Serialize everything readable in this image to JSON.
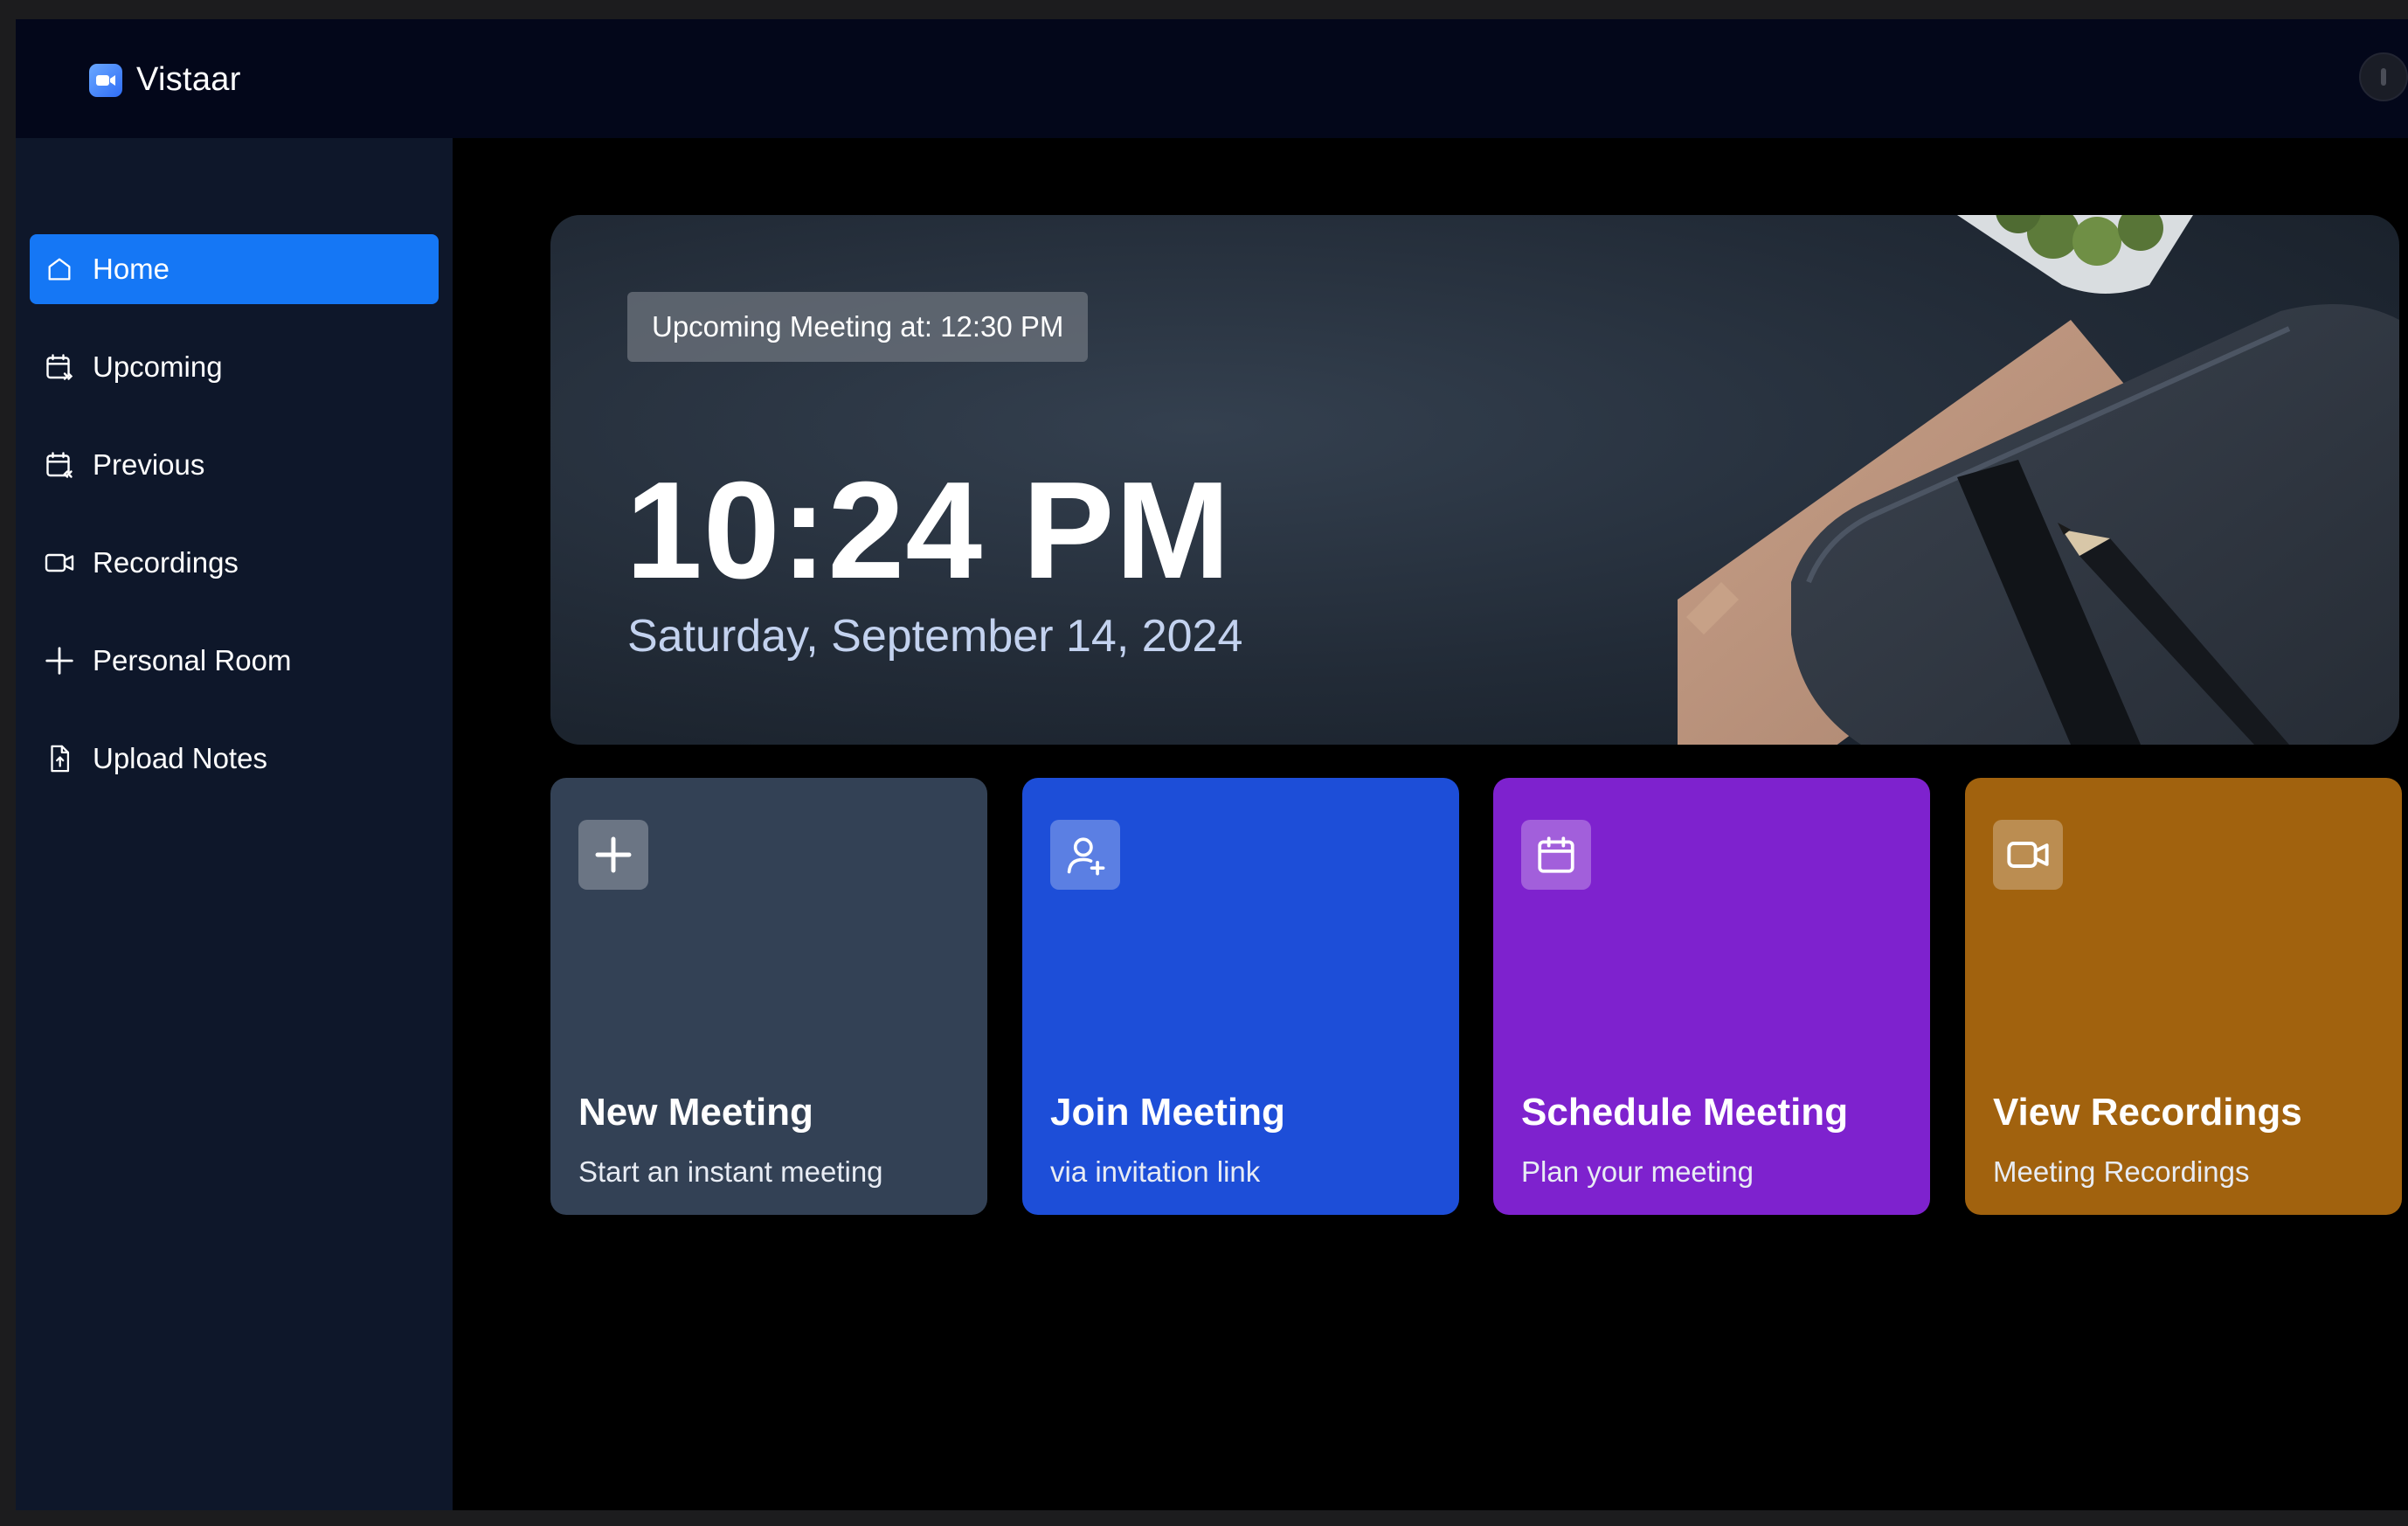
{
  "app": {
    "name": "Vistaar"
  },
  "sidebar": {
    "items": [
      {
        "label": "Home",
        "icon": "home-icon",
        "active": true
      },
      {
        "label": "Upcoming",
        "icon": "calendar-forward-icon",
        "active": false
      },
      {
        "label": "Previous",
        "icon": "calendar-back-icon",
        "active": false
      },
      {
        "label": "Recordings",
        "icon": "video-icon",
        "active": false
      },
      {
        "label": "Personal Room",
        "icon": "plus-icon",
        "active": false
      },
      {
        "label": "Upload Notes",
        "icon": "file-upload-icon",
        "active": false
      }
    ]
  },
  "hero": {
    "badge": "Upcoming Meeting at: 12:30 PM",
    "time": "10:24 PM",
    "date": "Saturday, September 14, 2024"
  },
  "cards": [
    {
      "title": "New Meeting",
      "subtitle": "Start an instant meeting",
      "icon": "plus-icon",
      "color": "#334155"
    },
    {
      "title": "Join Meeting",
      "subtitle": "via invitation link",
      "icon": "user-plus-icon",
      "color": "#1d4ed8"
    },
    {
      "title": "Schedule Meeting",
      "subtitle": "Plan your meeting",
      "icon": "calendar-icon",
      "color": "#7e22ce"
    },
    {
      "title": "View Recordings",
      "subtitle": "Meeting Recordings",
      "icon": "video-icon",
      "color": "#a1620e"
    }
  ],
  "colors": {
    "accent": "#1577f5",
    "sidebar_bg": "#0e172a",
    "topbar_bg": "#03071a"
  }
}
